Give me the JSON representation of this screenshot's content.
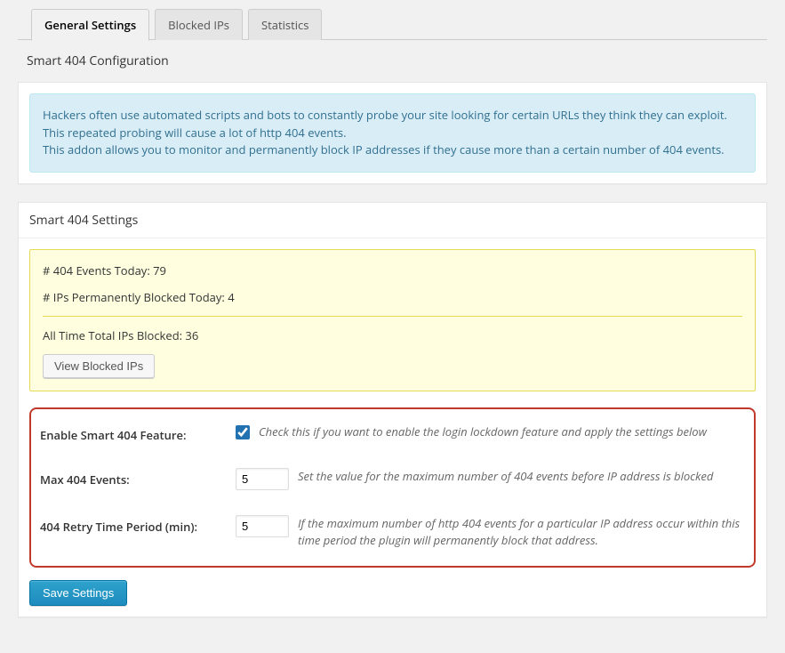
{
  "tabs": {
    "general": "General Settings",
    "blocked": "Blocked IPs",
    "stats": "Statistics"
  },
  "section_title": "Smart 404 Configuration",
  "info": {
    "line1": "Hackers often use automated scripts and bots to constantly probe your site looking for certain URLs they think they can exploit.",
    "line2": "This repeated probing will cause a lot of http 404 events.",
    "line3": "This addon allows you to monitor and permanently block IP addresses if they cause more than a certain number of 404 events."
  },
  "settings_title": "Smart 404 Settings",
  "stats": {
    "events_today": "# 404 Events Today: 79",
    "ips_blocked_today": "# IPs Permanently Blocked Today: 4",
    "all_time_blocked": "All Time Total IPs Blocked: 36",
    "view_button": "View Blocked IPs"
  },
  "form": {
    "enable": {
      "label": "Enable Smart 404 Feature:",
      "checked": true,
      "desc": "Check this if you want to enable the login lockdown feature and apply the settings below"
    },
    "max_events": {
      "label": "Max 404 Events:",
      "value": "5",
      "desc": "Set the value for the maximum number of 404 events before IP address is blocked"
    },
    "retry_period": {
      "label": "404 Retry Time Period (min):",
      "value": "5",
      "desc": "If the maximum number of http 404 events for a particular IP address occur within this time period the plugin will permanently block that address."
    }
  },
  "save_button": "Save Settings"
}
